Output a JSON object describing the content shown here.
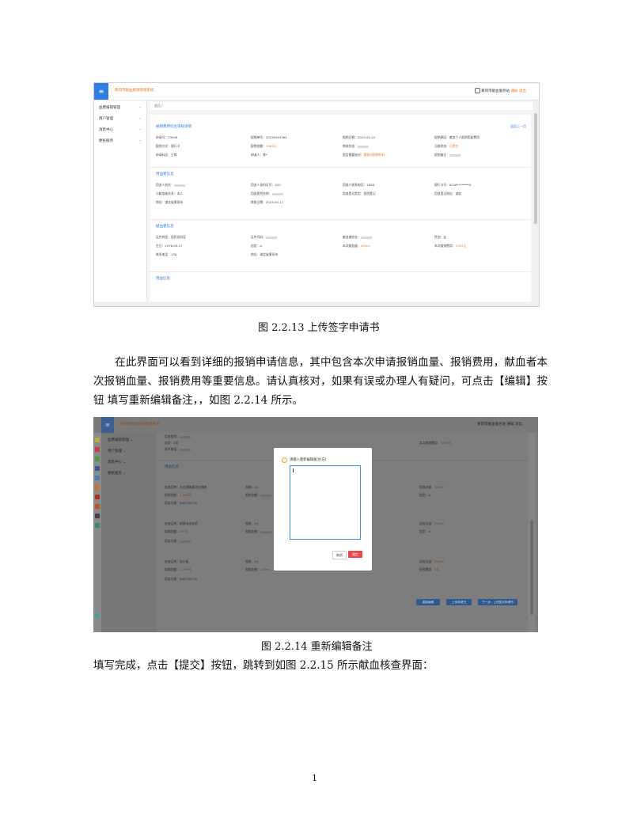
{
  "figure1": {
    "caption": "图 2.2.13 上传签字申请书",
    "app_title": "黄冈市献血报销管理系统",
    "top_right": {
      "user": "黄冈市献血服务站",
      "warn": "通知",
      "logout": "退出"
    },
    "sidebar": [
      "血费报销管理",
      "用户管理",
      "消息中心",
      "便民服务"
    ],
    "breadcrumb": "首页 /",
    "back_label": "返回上一页",
    "sections": [
      {
        "title": "报销费用综合审核详情",
        "fields": [
          [
            "申请号：",
            "23048"
          ],
          [
            "报销单号：",
            "20230503384"
          ],
          [
            "报销日期：",
            "2023-05-12"
          ],
          [
            "报销原因：",
            "献血个人报销用血费用"
          ],
          [
            "报销方式：",
            "银行卡"
          ],
          [
            "报销金额：",
            "1563元"
          ],
          [
            "审核状态：",
            ""
          ],
          [
            "当前状态：",
            "已提交"
          ],
          [
            "申请标志：",
            "正常"
          ],
          [
            "申请人：",
            "陈*"
          ],
          [
            "是否需要核对：",
            "需核对报销材料"
          ],
          [
            "报销备注：",
            ""
          ]
        ]
      },
      {
        "title": "用血者信息",
        "fields": [
          [
            "用血人姓名：",
            ""
          ],
          [
            "用血人身份证号：",
            "420"
          ],
          [
            "用血人联系电话：",
            "1858"
          ],
          [
            "银行卡号：",
            "6228********9"
          ],
          [
            "与献血者关系：",
            "本人"
          ],
          [
            "用血医院名称：",
            ""
          ],
          [
            "用血登记类型：",
            "医院登记"
          ],
          [
            "用血登记地址：",
            "湖北"
          ],
          [
            "地址：",
            "湖北省黄冈市"
          ],
          [
            "转账日期：",
            "2023-05-17"
          ]
        ]
      },
      {
        "title": "献血者信息",
        "fields": [
          [
            "证件类型：",
            "居民身份证"
          ],
          [
            "证件号码：",
            ""
          ],
          [
            "献血者姓名：",
            ""
          ],
          [
            "性别：",
            "女"
          ],
          [
            "生日：",
            "1976-05-17"
          ],
          [
            "血型：",
            "A"
          ],
          [
            "本次献血量：",
            "400ml"
          ],
          [
            "本次报销费用：",
            "1563元"
          ],
          [
            "联系电话：",
            "138"
          ],
          [
            "地址：",
            "湖北省黄冈市"
          ]
        ]
      },
      {
        "title": "用血信息",
        "fields": []
      }
    ]
  },
  "paragraph1": "在此界面可以看到详细的报销申请信息，其中包含本次申请报销血量、报销费用，献血者本次报销血量、报销费用等重要信息。请认真核对，如果有误或办理人有疑问，可点击【编辑】按钮 填写重新编辑备注，，如图 2.2.14 所示。",
  "figure2": {
    "caption": "图 2.2.14 重新编辑备注",
    "app_title": "黄冈市献血报销管理系统",
    "top_right": "黄冈市献血服务站  通知  退出",
    "sidebar": [
      "血费报销管理",
      "用户管理",
      "消息中心",
      "便民服务"
    ],
    "background_fields": [
      [
        "用血医院：",
        ""
      ],
      [
        "血型：",
        "A型"
      ],
      [
        "联系电话：",
        ""
      ],
      [
        "本次报销费用：",
        "1563元"
      ]
    ],
    "section_title": "用血信息",
    "rows": [
      [
        [
          "血液品种：",
          "去白细胞悬浮红细胞"
        ],
        [
          "规格：",
          "1U"
        ],
        [
          "用血总量：",
          "200ml"
        ]
      ],
      [
        [
          "报销金额：",
          "1,296元"
        ],
        [
          "报销金额：",
          ""
        ],
        [
          "血型：",
          "A"
        ]
      ],
      [
        [
          "用血日期：",
          "2023-05-10"
        ]
      ],
      [
        [
          "血液品种：",
          "新鲜冰冻血浆"
        ],
        [
          "规格：",
          "1U"
        ],
        [
          "用血总量：",
          "200ml"
        ]
      ],
      [
        [
          "报销金额：",
          "267元"
        ],
        [
          "报销金额：",
          ""
        ],
        [
          "血型：",
          "A"
        ]
      ],
      [
        [
          "用血日期：",
          ""
        ]
      ],
      [
        [
          "血液品种：",
          "血小板"
        ],
        [
          "规格：",
          "1U"
        ],
        [
          "用血总量：",
          "200ml"
        ]
      ],
      [
        [
          "报销金额：",
          "1,296元"
        ],
        [
          "报销金额：",
          "200ml"
        ],
        [
          "报销费用：",
          "0元"
        ]
      ],
      [
        [
          "用血日期：",
          "2023-05-10"
        ]
      ]
    ],
    "buttons": [
      "重新编辑",
      "上传申请书",
      "下一步：上传签字申请书"
    ],
    "modal": {
      "title": "请输入重新编辑备注(已)",
      "cancel": "取消",
      "ok": "确定"
    }
  },
  "paragraph2": "填写完成，点击【提交】按钮，跳转到如图 2.2.15 所示献血核查界面：",
  "page_number": "1"
}
